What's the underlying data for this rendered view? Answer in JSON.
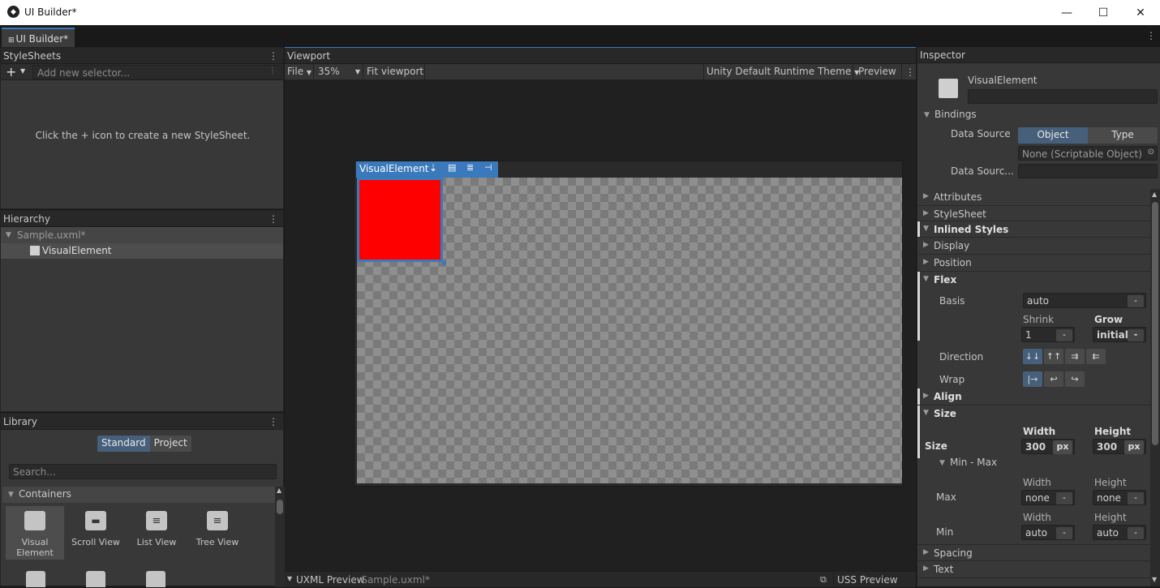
{
  "window": {
    "title": "UI Builder*",
    "minimize": "—",
    "maximize": "☐",
    "close": "✕"
  },
  "tab": {
    "label": "UI Builder*"
  },
  "stylesheets": {
    "header": "StyleSheets",
    "add_button": "+",
    "selector_placeholder": "Add new selector...",
    "empty_message": "Click the + icon to create a new StyleSheet."
  },
  "hierarchy": {
    "header": "Hierarchy",
    "root": "Sample.uxml*",
    "items": [
      "VisualElement"
    ]
  },
  "library": {
    "header": "Library",
    "tabs": [
      "Standard",
      "Project"
    ],
    "search_placeholder": "Search...",
    "section": "Containers",
    "items": [
      "Visual Element",
      "Scroll View",
      "List View",
      "Tree View"
    ]
  },
  "viewport": {
    "header": "Viewport",
    "file_menu": "File",
    "zoom": "35%",
    "fit": "Fit viewport",
    "theme": "Unity Default Runtime Theme",
    "preview": "Preview",
    "element_label": "VisualElement",
    "element_color": "#ff0000",
    "uxml_preview": "UXML Preview",
    "uxml_file": "-Sample.uxml*",
    "uss_preview": "USS Preview"
  },
  "inspector": {
    "header": "Inspector",
    "element_name": "VisualElement",
    "bindings": "Bindings",
    "data_source_label": "Data Source",
    "data_source_options": [
      "Object",
      "Type"
    ],
    "data_source_value": "None (Scriptable Object)",
    "data_source_path_label": "Data Sourc...",
    "sections": {
      "attributes": "Attributes",
      "stylesheet": "StyleSheet",
      "inlined_styles": "Inlined Styles",
      "display": "Display",
      "position": "Position",
      "flex": "Flex",
      "align": "Align",
      "size": "Size",
      "spacing": "Spacing",
      "text": "Text"
    },
    "flex": {
      "basis_label": "Basis",
      "basis_value": "auto",
      "shrink_label": "Shrink",
      "shrink_value": "1",
      "grow_label": "Grow",
      "grow_value": "initial",
      "direction_label": "Direction",
      "wrap_label": "Wrap",
      "minus": "-"
    },
    "size": {
      "size_label": "Size",
      "width_label": "Width",
      "height_label": "Height",
      "width_value": "300",
      "height_value": "300",
      "unit": "px",
      "minmax_label": "Min - Max",
      "max_label": "Max",
      "max_width": "none",
      "max_height": "none",
      "min_label": "Min",
      "min_width": "auto",
      "min_height": "auto"
    }
  }
}
